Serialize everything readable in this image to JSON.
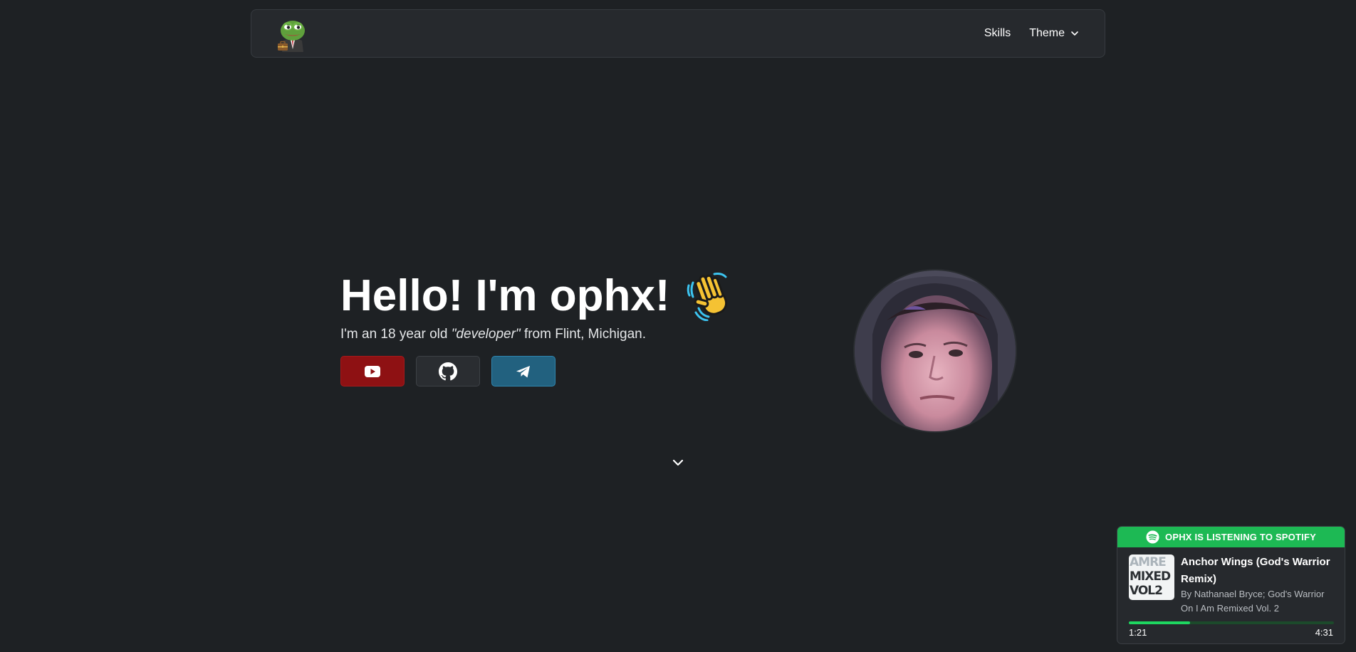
{
  "navbar": {
    "logo_icon": "pepe-frog-logo-icon",
    "links": [
      {
        "label": "Skills"
      },
      {
        "label": "Theme",
        "icon": "chevron-down-icon"
      }
    ]
  },
  "hero": {
    "greeting": "Hello! I'm ophx!",
    "wave_icon": "waving-hand-icon",
    "subtitle_before": "I'm an 18 year old ",
    "subtitle_emphasis": "\"developer\"",
    "subtitle_after": " from Flint, Michigan.",
    "socials": [
      {
        "name": "YouTube",
        "icon": "youtube-icon",
        "color": "#8e1113"
      },
      {
        "name": "GitHub",
        "icon": "github-icon",
        "color": "#2a2d31"
      },
      {
        "name": "Telegram",
        "icon": "telegram-icon",
        "color": "#22617f"
      }
    ],
    "avatar": "profile-photo",
    "scroll_icon": "chevron-down-icon"
  },
  "spotify": {
    "header": "OPHX IS LISTENING TO SPOTIFY",
    "brand_color": "#1db954",
    "album_art_text": [
      "AMRE",
      "MIXED",
      "VOL2"
    ],
    "track_title": "Anchor Wings (God's Warrior Remix)",
    "track_artist": "By Nathanael Bryce; God's Warrior On I Am Remixed Vol. 2",
    "elapsed": "1:21",
    "duration": "4:31",
    "progress_fraction": 0.3
  }
}
